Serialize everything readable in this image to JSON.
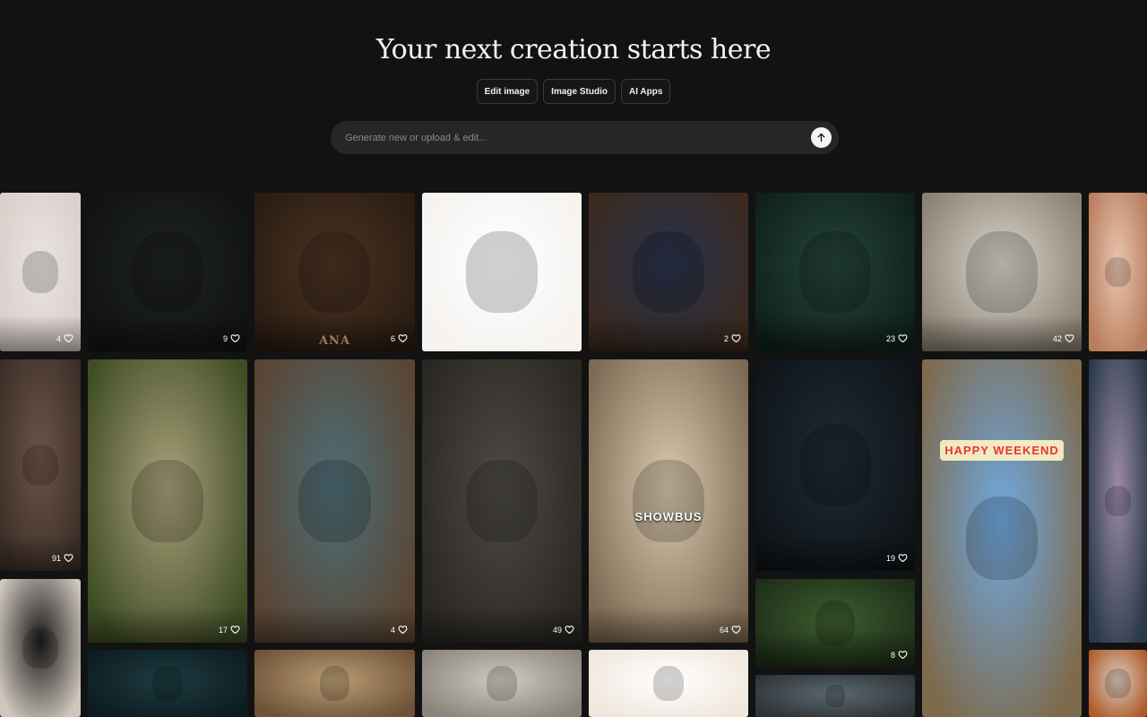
{
  "header": {
    "title": "Your next creation starts here",
    "chips": [
      "Edit image",
      "Image Studio",
      "AI Apps"
    ]
  },
  "prompt": {
    "placeholder": "Generate new or upload & edit...",
    "send_icon": "arrow-up-icon"
  },
  "gallery": {
    "tiles": [
      {
        "name": "tile-llama-flowers",
        "likes": "4",
        "colors": [
          "#e9e3df",
          "#d9cfcb"
        ]
      },
      {
        "name": "tile-cat-detective",
        "likes": "9",
        "colors": [
          "#1e2221",
          "#111313"
        ]
      },
      {
        "name": "tile-blue-cat-ana",
        "likes": "6",
        "colors": [
          "#4a3322",
          "#2a1c12"
        ],
        "label": "ANA"
      },
      {
        "name": "tile-highland-cow",
        "likes": "",
        "colors": [
          "#ffffff",
          "#f5f2ef"
        ]
      },
      {
        "name": "tile-wizard-cat",
        "likes": "2",
        "colors": [
          "#27314d",
          "#3b2a1e"
        ]
      },
      {
        "name": "tile-penguin-forest",
        "likes": "23",
        "colors": [
          "#244437",
          "#0f2119"
        ]
      },
      {
        "name": "tile-woman-sitting",
        "likes": "42",
        "colors": [
          "#d8d4cc",
          "#8b8173"
        ]
      },
      {
        "name": "tile-sunset-birds",
        "likes": "",
        "colors": [
          "#e9c6ae",
          "#b87c5e"
        ]
      },
      {
        "name": "tile-torn-portrait",
        "likes": "91",
        "colors": [
          "#6a5448",
          "#3d2f28"
        ]
      },
      {
        "name": "tile-pumpkin-house",
        "likes": "17",
        "colors": [
          "#a9a07a",
          "#3f4d25"
        ]
      },
      {
        "name": "tile-puppy-bike",
        "likes": "4",
        "colors": [
          "#4c6e78",
          "#5b4432"
        ]
      },
      {
        "name": "tile-victorian-dolls",
        "likes": "49",
        "colors": [
          "#4d4a44",
          "#2a2722"
        ]
      },
      {
        "name": "tile-showbus",
        "likes": "64",
        "colors": [
          "#d8c8ad",
          "#7c6a54"
        ],
        "label": "SHOWBUS"
      },
      {
        "name": "tile-goblin",
        "likes": "19",
        "colors": [
          "#1d2a33",
          "#0f1418"
        ]
      },
      {
        "name": "tile-happy-weekend-bear",
        "likes": "",
        "colors": [
          "#6fa8e0",
          "#7e6a4c"
        ],
        "label": "HAPPY WEEKEND"
      },
      {
        "name": "tile-mountain-lake",
        "likes": "",
        "colors": [
          "#9a8aa6",
          "#2b3a4b"
        ]
      },
      {
        "name": "tile-pink-kitten",
        "likes": "8",
        "colors": [
          "#3c5c2e",
          "#1e2e18"
        ]
      },
      {
        "name": "tile-blonde-woman",
        "likes": "",
        "colors": [
          "#1b1b1b",
          "#cfc6bc"
        ]
      },
      {
        "name": "tile-owl",
        "likes": "",
        "colors": [
          "#1c3b41",
          "#0d1c20"
        ]
      },
      {
        "name": "tile-woman-archway",
        "likes": "",
        "colors": [
          "#b99d74",
          "#6f5138"
        ]
      },
      {
        "name": "tile-girl-painting",
        "likes": "",
        "colors": [
          "#cfcac2",
          "#8a847b"
        ]
      },
      {
        "name": "tile-cat-wood",
        "likes": "",
        "colors": [
          "#ffffff",
          "#f0e6dc"
        ]
      },
      {
        "name": "tile-street",
        "likes": "",
        "colors": [
          "#5b6770",
          "#2d3438"
        ]
      },
      {
        "name": "tile-redhead",
        "likes": "",
        "colors": [
          "#d8cdc0",
          "#b05a2a"
        ]
      }
    ]
  }
}
